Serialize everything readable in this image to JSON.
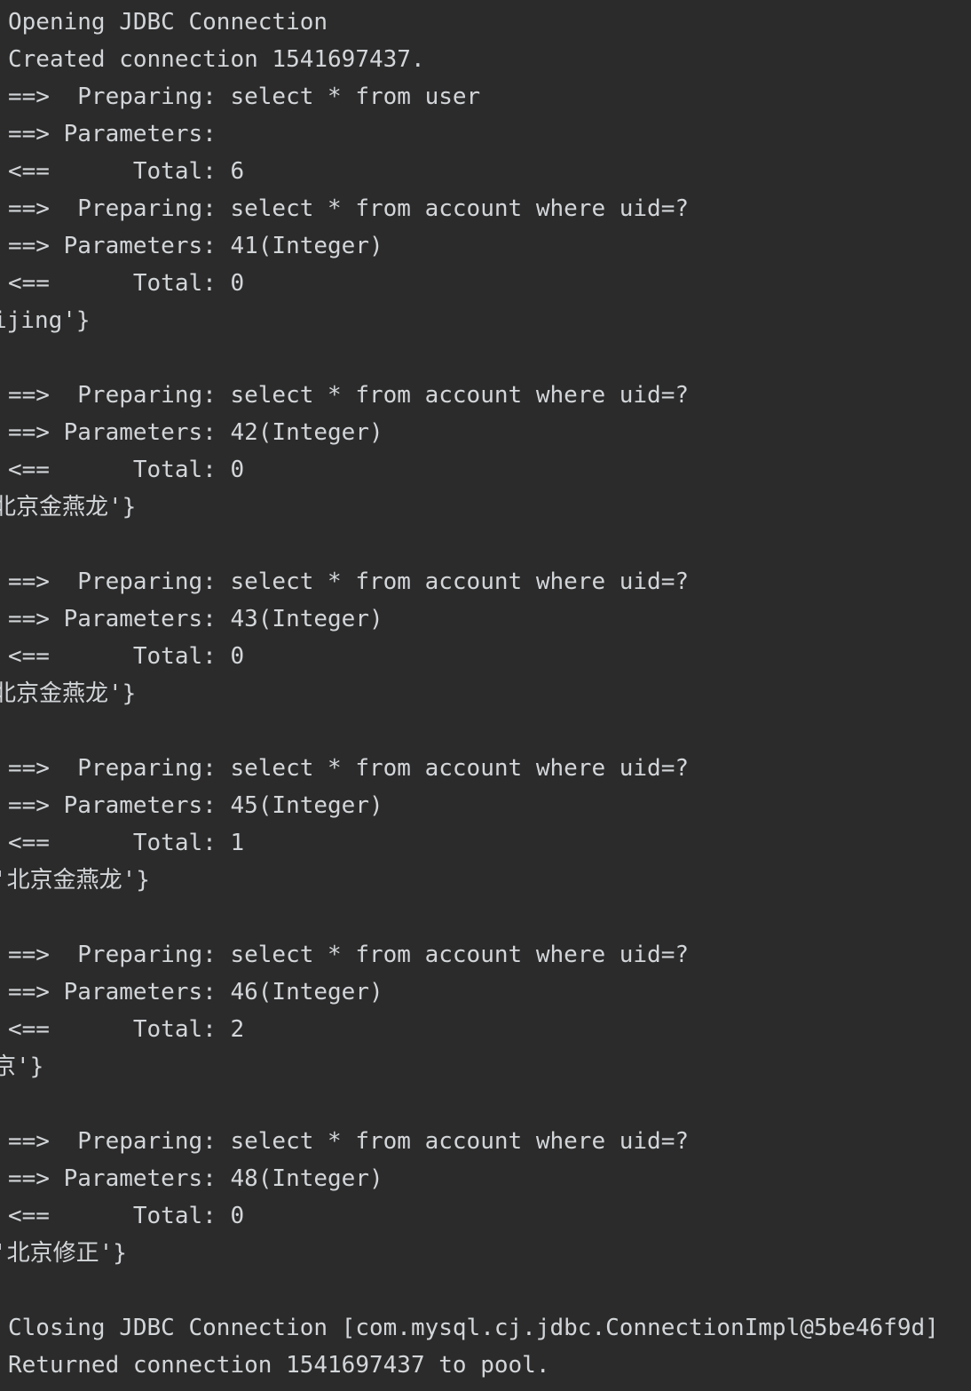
{
  "console": {
    "lines": [
      "Opening JDBC Connection",
      "Created connection 1541697437.",
      "==>  Preparing: select * from user",
      "==> Parameters: ",
      "<==      Total: 6",
      "==>  Preparing: select * from account where uid=?",
      "==> Parameters: 41(Integer)",
      "<==      Total: 0",
      "ijing'}",
      "",
      "==>  Preparing: select * from account where uid=?",
      "==> Parameters: 42(Integer)",
      "<==      Total: 0",
      "北京金燕龙'}",
      "",
      "==>  Preparing: select * from account where uid=?",
      "==> Parameters: 43(Integer)",
      "<==      Total: 0",
      "北京金燕龙'}",
      "",
      "==>  Preparing: select * from account where uid=?",
      "==> Parameters: 45(Integer)",
      "<==      Total: 1",
      "'北京金燕龙'}",
      "",
      "==>  Preparing: select * from account where uid=?",
      "==> Parameters: 46(Integer)",
      "<==      Total: 2",
      "京'}",
      "",
      "==>  Preparing: select * from account where uid=?",
      "==> Parameters: 48(Integer)",
      "<==      Total: 0",
      "'北京修正'}",
      "",
      "Closing JDBC Connection [com.mysql.cj.jdbc.ConnectionImpl@5be46f9d]",
      "Returned connection 1541697437 to pool."
    ]
  }
}
